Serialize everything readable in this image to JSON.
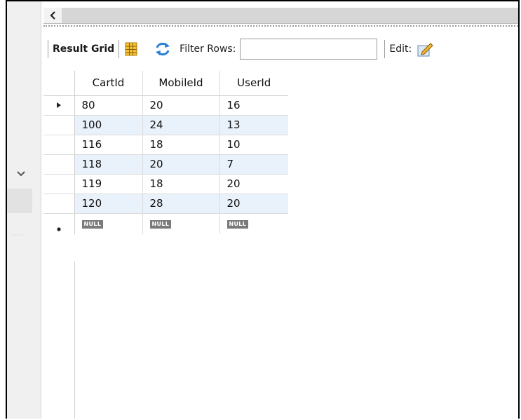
{
  "toolbar": {
    "result_grid_label": "Result Grid",
    "filter_label": "Filter Rows:",
    "filter_value": "",
    "edit_label": "Edit:"
  },
  "grid": {
    "columns": [
      "CartId",
      "MobileId",
      "UserId"
    ],
    "rows": [
      [
        "80",
        "20",
        "16"
      ],
      [
        "100",
        "24",
        "13"
      ],
      [
        "116",
        "18",
        "10"
      ],
      [
        "118",
        "20",
        "7"
      ],
      [
        "119",
        "18",
        "20"
      ],
      [
        "120",
        "28",
        "20"
      ]
    ],
    "new_row": [
      "NULL",
      "NULL",
      "NULL"
    ]
  },
  "icons": {
    "scroll_left": "chevron-left-icon",
    "gutter_toggle": "chevron-down-icon",
    "grid_view": "grid-columns-icon",
    "refresh": "refresh-icon",
    "edit": "pencil-edit-icon",
    "current_row": "row-pointer-icon",
    "new_row": "new-row-icon"
  },
  "colors": {
    "alt_row": "#e9f1fb",
    "null_badge": "#7a7a7a"
  }
}
